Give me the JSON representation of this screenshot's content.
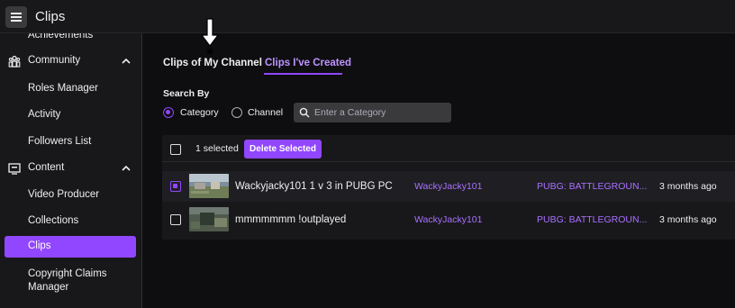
{
  "app": {
    "title": "Clips",
    "menu_icon": "hamburger-icon"
  },
  "sidebar": {
    "items": [
      {
        "label": "Achievements",
        "type": "sub"
      },
      {
        "label": "Community",
        "type": "group",
        "icon": "community-icon"
      },
      {
        "label": "Roles Manager",
        "type": "sub"
      },
      {
        "label": "Activity",
        "type": "sub"
      },
      {
        "label": "Followers List",
        "type": "sub"
      },
      {
        "label": "Content",
        "type": "group",
        "icon": "content-icon"
      },
      {
        "label": "Video Producer",
        "type": "sub"
      },
      {
        "label": "Collections",
        "type": "sub"
      },
      {
        "label": "Clips",
        "type": "sub",
        "active": true
      },
      {
        "label": "Copyright Claims",
        "label2": "Manager",
        "type": "sub"
      }
    ]
  },
  "tabs": [
    {
      "label": "Clips of My Channel",
      "active": false
    },
    {
      "label": "Clips I've Created",
      "active": true
    }
  ],
  "search": {
    "heading": "Search By",
    "options": [
      {
        "label": "Category",
        "selected": true
      },
      {
        "label": "Channel",
        "selected": false
      }
    ],
    "placeholder": "Enter a Category"
  },
  "table": {
    "selected_count": "1 selected",
    "delete_label": "Delete Selected",
    "rows": [
      {
        "checked": true,
        "title": "Wackyjacky101 1 v 3 in PUBG PC",
        "creator": "WackyJacky101",
        "category": "PUBG: BATTLEGROUN...",
        "date": "3 months ago"
      },
      {
        "checked": false,
        "title": "mmmmmmm !outplayed",
        "creator": "WackyJacky101",
        "category": "PUBG: BATTLEGROUN...",
        "date": "3 months ago"
      }
    ]
  },
  "colors": {
    "accent": "#9147ff",
    "link": "#a970ff",
    "bg": "#0e0e10",
    "panel": "#18181b"
  }
}
